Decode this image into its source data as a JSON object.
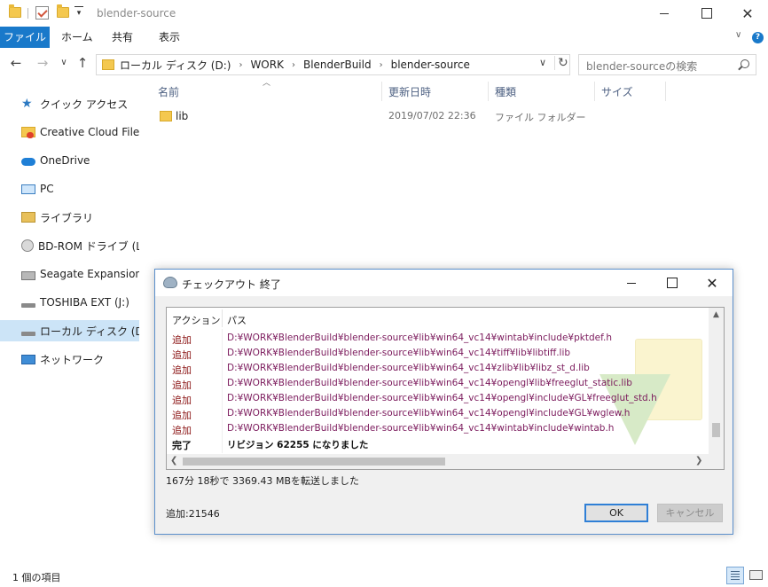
{
  "window": {
    "title": "blender-source"
  },
  "ribbon": {
    "tabs": [
      "ファイル",
      "ホーム",
      "共有",
      "表示"
    ]
  },
  "address": {
    "crumbs": [
      "ローカル ディスク (D:)",
      "WORK",
      "BlenderBuild",
      "blender-source"
    ]
  },
  "search": {
    "placeholder": "blender-sourceの検索"
  },
  "sidebar": {
    "items": [
      {
        "label": "クイック アクセス",
        "icon": "star-icon"
      },
      {
        "label": "Creative Cloud Files",
        "icon": "creative-cloud-icon"
      },
      {
        "label": "OneDrive",
        "icon": "cloud-icon"
      },
      {
        "label": "PC",
        "icon": "pc-icon"
      },
      {
        "label": "ライブラリ",
        "icon": "library-icon"
      },
      {
        "label": "BD-ROM ドライブ (L:) M",
        "icon": "disc-icon"
      },
      {
        "label": "Seagate Expansion Dr",
        "icon": "drive-icon"
      },
      {
        "label": "TOSHIBA EXT (J:)",
        "icon": "drive-icon"
      },
      {
        "label": "ローカル ディスク (D:)",
        "icon": "drive-icon"
      },
      {
        "label": "ネットワーク",
        "icon": "network-icon"
      }
    ]
  },
  "filelist": {
    "columns": [
      "名前",
      "更新日時",
      "種類",
      "サイズ"
    ],
    "rows": [
      {
        "name": "lib",
        "modified": "2019/07/02 22:36",
        "type": "ファイル フォルダー",
        "size": ""
      }
    ]
  },
  "statusbar": {
    "count": "1 個の項目"
  },
  "dialog": {
    "title": "チェックアウト 終了",
    "columns": {
      "action": "アクション",
      "path": "パス"
    },
    "rows": [
      {
        "action": "追加",
        "path": "D:¥WORK¥BlenderBuild¥blender-source¥lib¥win64_vc14¥wintab¥include¥pktdef.h"
      },
      {
        "action": "追加",
        "path": "D:¥WORK¥BlenderBuild¥blender-source¥lib¥win64_vc14¥tiff¥lib¥libtiff.lib"
      },
      {
        "action": "追加",
        "path": "D:¥WORK¥BlenderBuild¥blender-source¥lib¥win64_vc14¥zlib¥lib¥libz_st_d.lib"
      },
      {
        "action": "追加",
        "path": "D:¥WORK¥BlenderBuild¥blender-source¥lib¥win64_vc14¥opengl¥lib¥freeglut_static.lib"
      },
      {
        "action": "追加",
        "path": "D:¥WORK¥BlenderBuild¥blender-source¥lib¥win64_vc14¥opengl¥include¥GL¥freeglut_std.h"
      },
      {
        "action": "追加",
        "path": "D:¥WORK¥BlenderBuild¥blender-source¥lib¥win64_vc14¥opengl¥include¥GL¥wglew.h"
      },
      {
        "action": "追加",
        "path": "D:¥WORK¥BlenderBuild¥blender-source¥lib¥win64_vc14¥wintab¥include¥wintab.h"
      },
      {
        "action": "完了",
        "path": "リビジョン 62255 になりました"
      }
    ],
    "transfer_text": "167分 18秒で 3369.43 MBを転送しました",
    "added_text": "追加:21546",
    "ok_label": "OK",
    "cancel_label": "キャンセル"
  },
  "colors": {
    "accent": "#1979ca",
    "selection": "#cce4f7",
    "action_text": "#8b1414",
    "path_text": "#7b1a5c"
  }
}
